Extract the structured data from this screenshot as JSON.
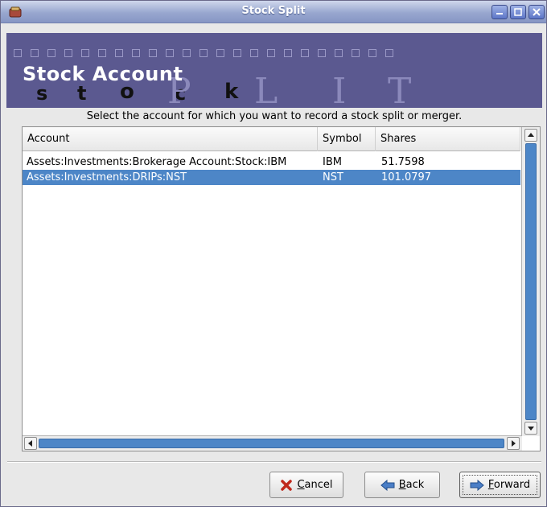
{
  "window": {
    "title": "Stock Split"
  },
  "banner": {
    "title": "Stock Account",
    "watermark_small": [
      "s",
      "t",
      "o",
      "c",
      "k"
    ],
    "watermark_big": [
      "P",
      "L",
      "I",
      "T"
    ]
  },
  "instruction": "Select the account for which you want to record a stock split or merger.",
  "table": {
    "columns": [
      "Account",
      "Symbol",
      "Shares"
    ],
    "rows": [
      {
        "account": "Assets:Investments:Brokerage Account:Stock:IBM",
        "symbol": "IBM",
        "shares": "51.7598",
        "selected": false
      },
      {
        "account": "Assets:Investments:DRIPs:NST",
        "symbol": "NST",
        "shares": "101.0797",
        "selected": true
      }
    ]
  },
  "buttons": {
    "cancel": {
      "mnemonic": "C",
      "rest": "ancel"
    },
    "back": {
      "mnemonic": "B",
      "rest": "ack"
    },
    "forward": {
      "mnemonic": "F",
      "rest": "orward"
    }
  },
  "colors": {
    "banner_bg": "#5b5990",
    "selection": "#4d86c7"
  }
}
